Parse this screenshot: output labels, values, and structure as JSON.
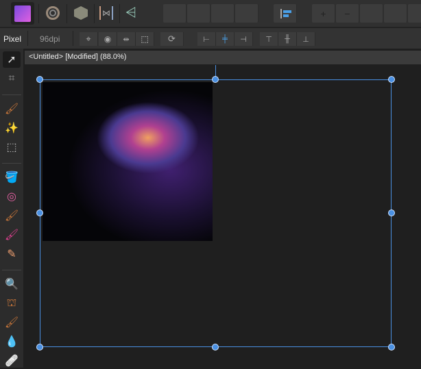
{
  "personas": [
    {
      "name": "photo-persona",
      "color": "#c04fe0"
    },
    {
      "name": "liquify-persona"
    },
    {
      "name": "develop-persona"
    },
    {
      "name": "tone-mapping-persona"
    },
    {
      "name": "export-persona"
    }
  ],
  "context": {
    "unit": "Pixel",
    "dpi": "96dpi"
  },
  "document": {
    "tab_label": "<Untitled> [Modified] (88.0%)"
  },
  "colors": {
    "accent": "#4a90e2",
    "toolbar": "#303030",
    "canvas": "#1f1f1f"
  }
}
